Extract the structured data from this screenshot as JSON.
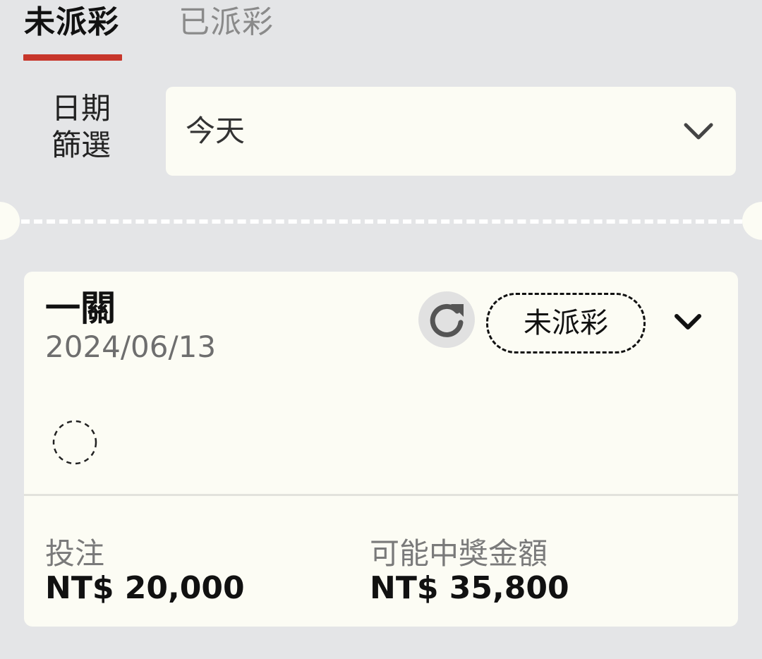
{
  "tabs": [
    {
      "label": "未派彩",
      "active": true
    },
    {
      "label": "已派彩",
      "active": false
    }
  ],
  "filter": {
    "label_line1": "日期",
    "label_line2": "篩選",
    "selected": "今天",
    "icon": "chevron-down-icon"
  },
  "bet_card": {
    "title": "一關",
    "date": "2024/06/13",
    "status": "未派彩",
    "refresh_icon": "refresh-icon",
    "expand_icon": "chevron-down-icon",
    "stake_label": "投注",
    "stake_value": "NT$ 20,000",
    "payout_label": "可能中獎金額",
    "payout_value": "NT$ 35,800"
  },
  "colors": {
    "accent": "#c7362b",
    "background": "#e4e5e7",
    "card": "#fcfcf4"
  }
}
